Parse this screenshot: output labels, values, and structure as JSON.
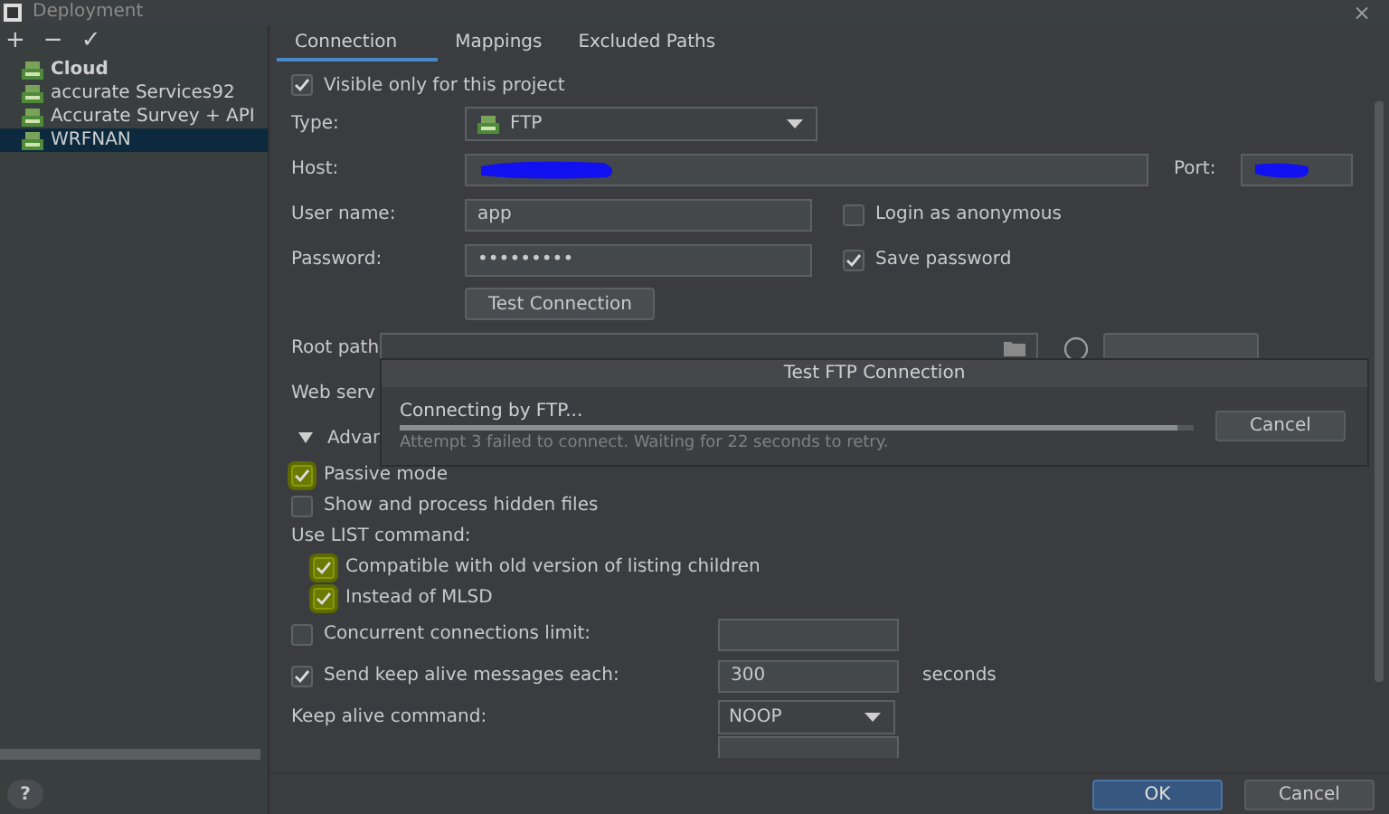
{
  "window": {
    "title": "Deployment",
    "close": "×"
  },
  "toolbar": [
    "+",
    "−",
    "✓"
  ],
  "servers": [
    {
      "name": "Cloud",
      "default": true,
      "selected": false
    },
    {
      "name": "accurate Services92",
      "default": false,
      "selected": false
    },
    {
      "name": "Accurate Survey + API",
      "default": false,
      "selected": false
    },
    {
      "name": "WRFNAN",
      "default": false,
      "selected": true
    }
  ],
  "tabs": [
    {
      "label": "Connection",
      "selected": true
    },
    {
      "label": "Mappings",
      "selected": false
    },
    {
      "label": "Excluded Paths",
      "selected": false
    }
  ],
  "form": [
    {
      "kind": "checkbox",
      "label": "Visible only for this project",
      "checked": true
    },
    {
      "kind": "dropdown",
      "label": "Type:",
      "value": "FTP"
    },
    {
      "kind": "host",
      "label": "Host:",
      "port_label": "Port:"
    },
    {
      "kind": "text",
      "label": "User name:",
      "value": "app",
      "option": {
        "label": "Login as anonymous",
        "checked": false
      }
    },
    {
      "kind": "text",
      "label": "Password:",
      "value": "•••••••••",
      "option": {
        "label": "Save password",
        "checked": true
      }
    },
    {
      "kind": "button",
      "label": "Test Connection"
    },
    {
      "kind": "path",
      "label": "Root path"
    },
    {
      "kind": "label",
      "label": "Web serv"
    },
    {
      "kind": "section",
      "label": "Advan",
      "expanded": true
    },
    {
      "kind": "checkbox",
      "label": "Passive mode",
      "checked": true,
      "highlighted": true
    },
    {
      "kind": "checkbox",
      "label": "Show and process hidden files",
      "checked": false,
      "highlighted": false
    },
    {
      "kind": "heading",
      "label": "Use  LIST command:"
    },
    {
      "kind": "sub_checkbox",
      "label": "Compatible with old version of listing children",
      "checked": true,
      "highlighted": true
    },
    {
      "kind": "sub_checkbox",
      "label": "Instead of MLSD",
      "checked": true,
      "highlighted": true
    },
    {
      "kind": "checkbox_field",
      "label": "Concurrent connections limit:",
      "checked": false
    },
    {
      "kind": "checkbox_field",
      "label": "Send keep alive messages each:",
      "checked": true,
      "value": "300",
      "unit": "seconds"
    },
    {
      "kind": "select",
      "label": "Keep alive command:",
      "value": "NOOP"
    },
    {
      "kind": "stub"
    }
  ],
  "dialog": {
    "title": "Test FTP Connection",
    "message": "Connecting by FTP...",
    "level": 0.98,
    "detail": "Attempt 3 failed to connect. Waiting for 22 seconds to retry.",
    "button": "Cancel"
  },
  "help": "?",
  "buttons": [
    {
      "label": "OK",
      "default": true
    },
    {
      "label": "Cancel",
      "default": false
    }
  ]
}
